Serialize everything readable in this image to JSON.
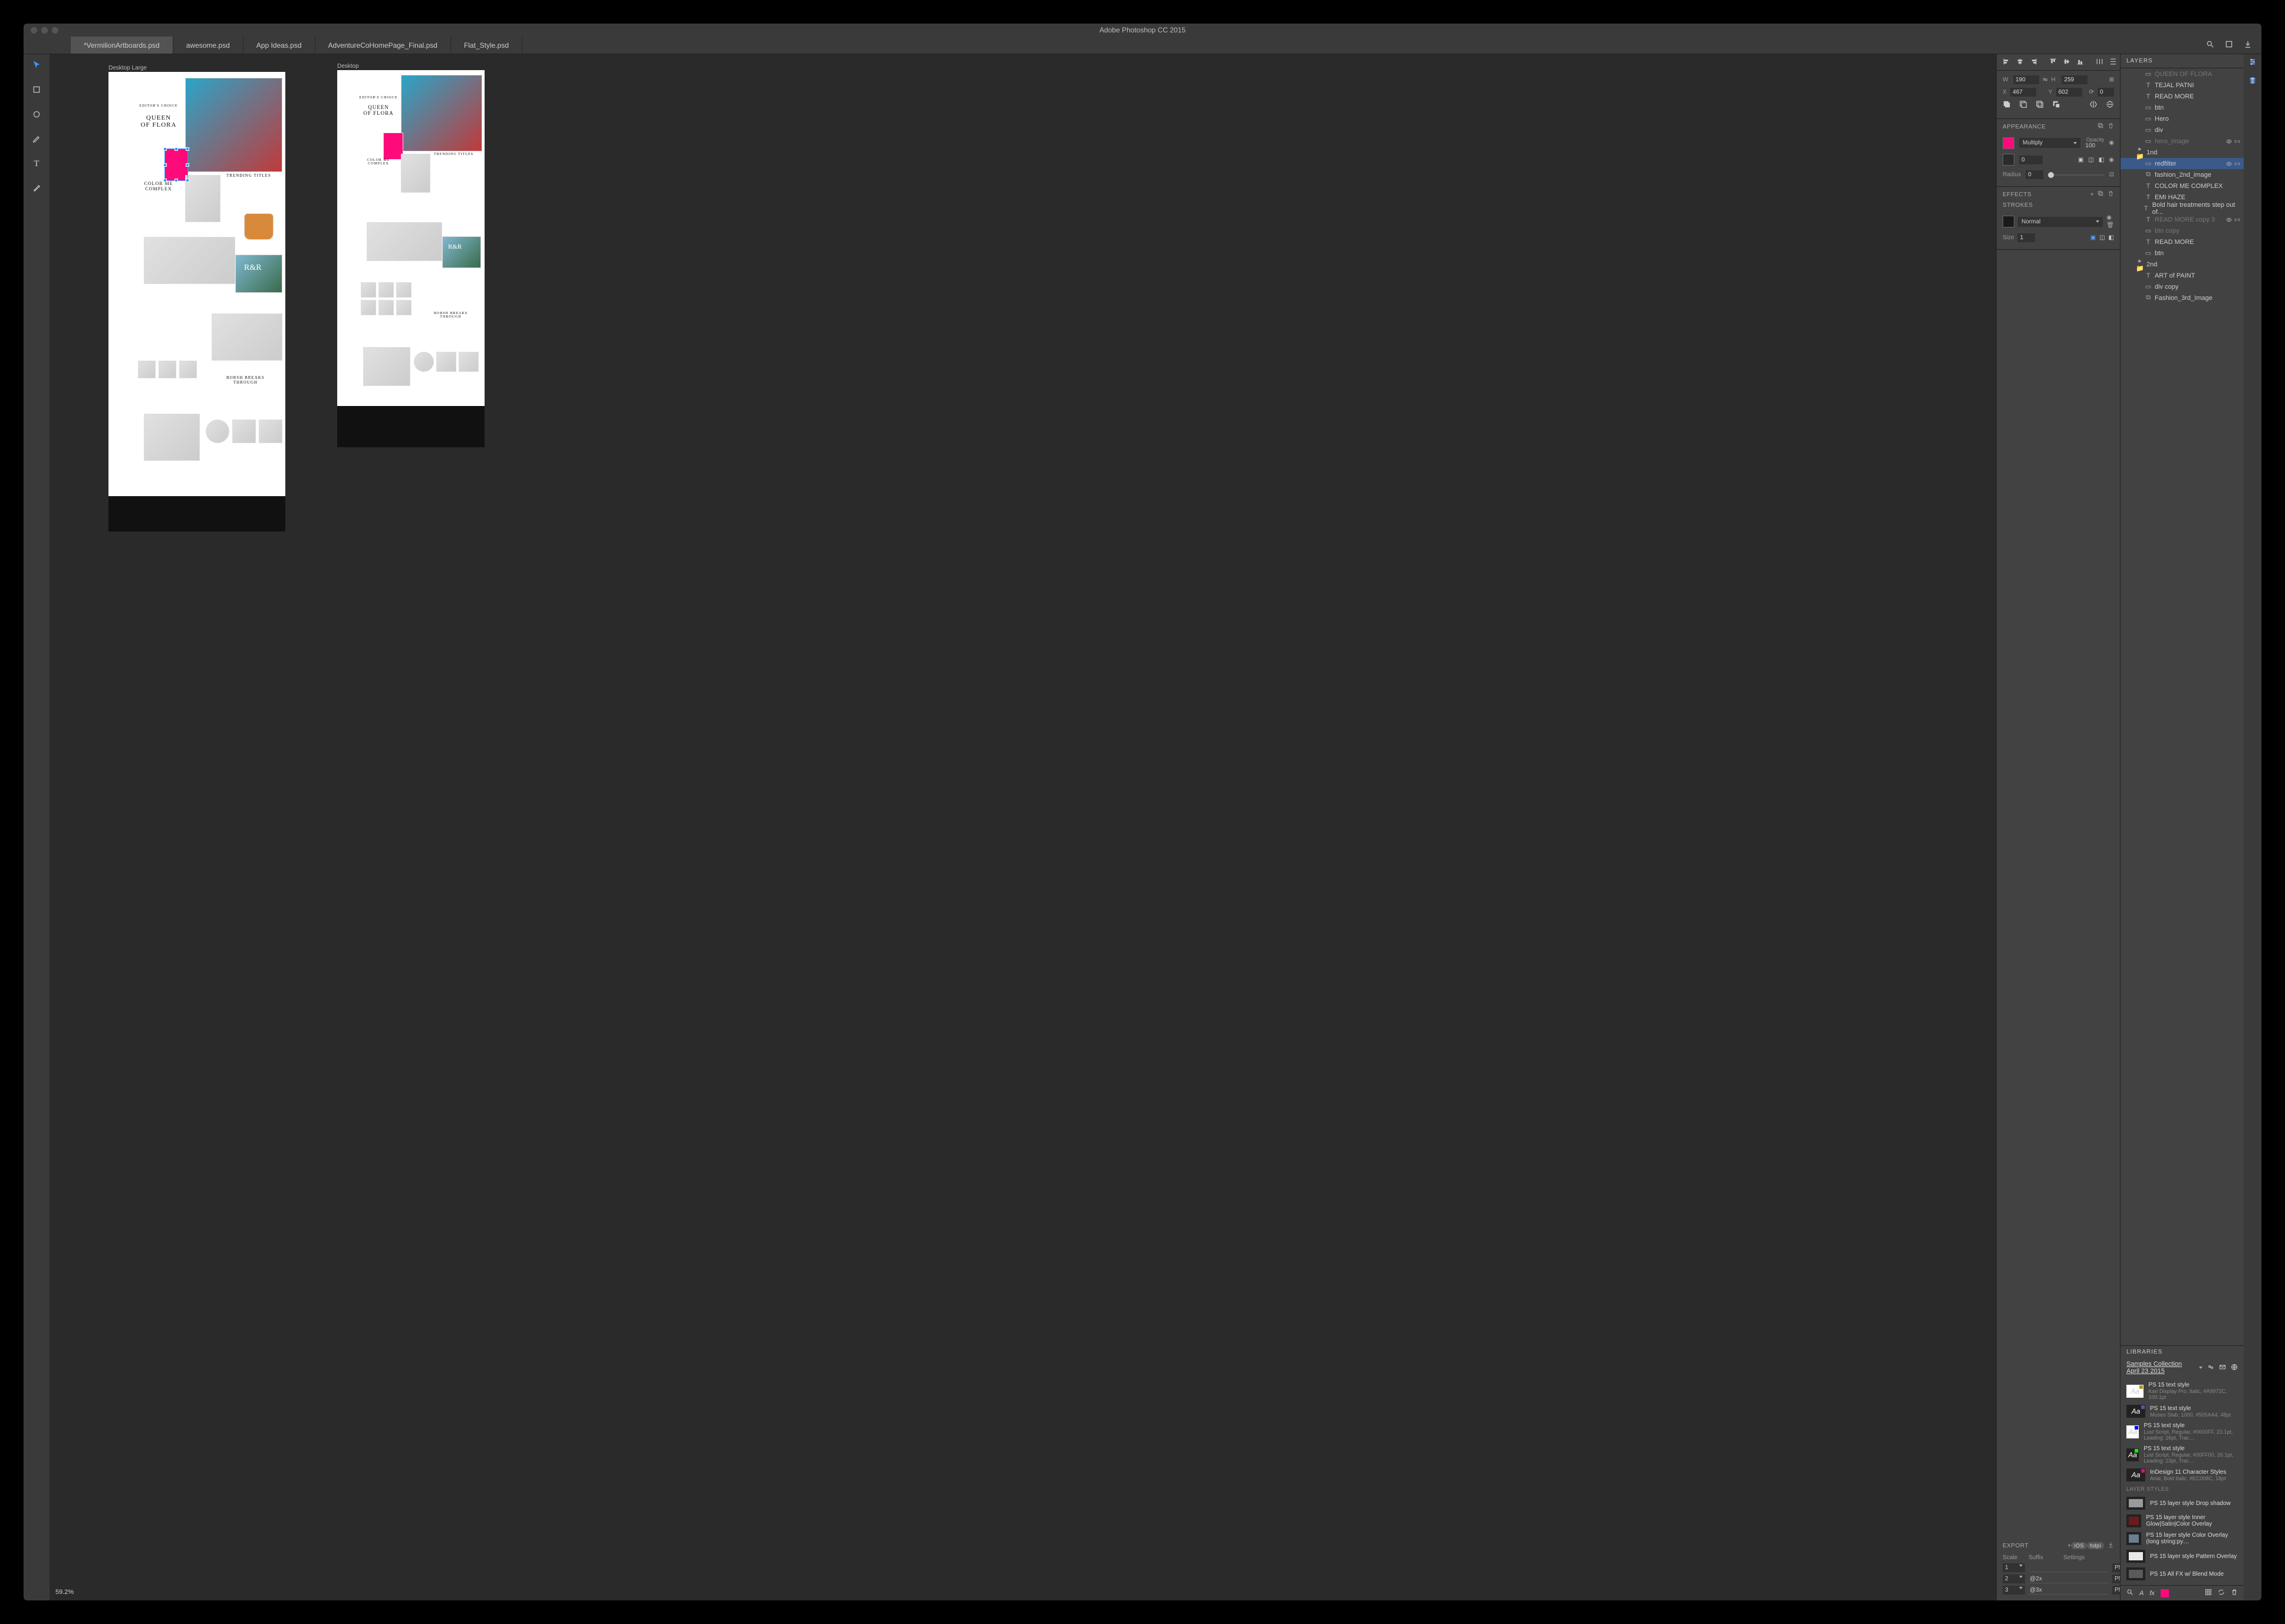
{
  "window": {
    "title": "Adobe Photoshop CC 2015"
  },
  "tabs": [
    {
      "label": "*VermilionArtboards.psd",
      "active": true
    },
    {
      "label": "awesome.psd",
      "active": false
    },
    {
      "label": "App Ideas.psd",
      "active": false
    },
    {
      "label": "AdventureCoHomePage_Final.psd",
      "active": false
    },
    {
      "label": "Flat_Style.psd",
      "active": false
    }
  ],
  "canvas": {
    "zoom": "59.2%",
    "artboards": [
      {
        "label": "Desktop Large"
      },
      {
        "label": "Desktop"
      }
    ]
  },
  "transform": {
    "W": "190",
    "H": "259",
    "X": "467",
    "Y": "602",
    "rotate": "0"
  },
  "appearance": {
    "title": "APPEARANCE",
    "fill": {
      "color": "#ff0a7b",
      "blend": "Multiply",
      "opacityLabel": "Opacity",
      "opacity": "100"
    },
    "stroke": {
      "color": "#2b2b2b",
      "weight": "0"
    },
    "radiusLabel": "Radius",
    "radius": "0"
  },
  "effects": {
    "title": "EFFECTS"
  },
  "strokes": {
    "title": "STROKES",
    "color": "#1a1a1a",
    "mode": "Normal",
    "sizeLabel": "Size",
    "size": "1"
  },
  "export": {
    "title": "EXPORT",
    "cols": {
      "scale": "Scale",
      "suffix": "Suffix",
      "settings": "Settings"
    },
    "badges": [
      "iOS",
      "hdpi"
    ],
    "rows": [
      {
        "scale": "1",
        "suffix": "",
        "format": "PNG"
      },
      {
        "scale": "2",
        "suffix": "@2x",
        "format": "PNG"
      },
      {
        "scale": "3",
        "suffix": "@3x",
        "format": "PNG"
      }
    ]
  },
  "layersPanel": {
    "title": "LAYERS",
    "items": [
      {
        "depth": 2,
        "kind": "rect",
        "name": "QUEEN OF FLORA",
        "dim": true
      },
      {
        "depth": 2,
        "kind": "text",
        "name": "TEJAL PATNI"
      },
      {
        "depth": 2,
        "kind": "text",
        "name": "READ MORE"
      },
      {
        "depth": 2,
        "kind": "rect",
        "name": "btn"
      },
      {
        "depth": 2,
        "kind": "rect",
        "name": "Hero"
      },
      {
        "depth": 2,
        "kind": "rect",
        "name": "div"
      },
      {
        "depth": 2,
        "kind": "rect",
        "name": "hero_image",
        "dim": true,
        "eye": true,
        "link": true
      },
      {
        "depth": 1,
        "kind": "folder",
        "name": "1nd"
      },
      {
        "depth": 2,
        "kind": "rect",
        "name": "redfilter",
        "selected": true,
        "eye": true,
        "link": true
      },
      {
        "depth": 2,
        "kind": "smart",
        "name": "fashion_2nd_image"
      },
      {
        "depth": 2,
        "kind": "text",
        "name": "COLOR ME COMPLEX"
      },
      {
        "depth": 2,
        "kind": "text",
        "name": "EMI HAZE"
      },
      {
        "depth": 2,
        "kind": "text",
        "name": "Bold hair treatments step out of..."
      },
      {
        "depth": 2,
        "kind": "text",
        "name": "READ MORE copy 3",
        "dim": true,
        "eye": true,
        "link": true
      },
      {
        "depth": 2,
        "kind": "rect",
        "name": "btn copy",
        "dim": true
      },
      {
        "depth": 2,
        "kind": "text",
        "name": "READ MORE"
      },
      {
        "depth": 2,
        "kind": "rect",
        "name": "btn"
      },
      {
        "depth": 1,
        "kind": "folder",
        "name": "2nd"
      },
      {
        "depth": 2,
        "kind": "text",
        "name": "ART of PAINT"
      },
      {
        "depth": 2,
        "kind": "rect",
        "name": "div copy"
      },
      {
        "depth": 2,
        "kind": "smart",
        "name": "Fashion_3rd_Image"
      }
    ]
  },
  "libraries": {
    "title": "LIBRARIES",
    "collection": "Samples Collection April 23 2015",
    "textStyles": [
      {
        "title": "PS 15 text style",
        "sub": "Kari Display Pro, Italic, #A9972C, 100.1pt",
        "dot": "#A9972C",
        "thumbDark": false
      },
      {
        "title": "PS 15 text style",
        "sub": "Museo Slab, 1000, #505AA4, 48pt",
        "dot": "#505AA4",
        "thumbDark": true
      },
      {
        "title": "PS 15 text style",
        "sub": "Lust Script, Regular, #0000FF, 23.1pt, Leading: 26pt, Trac…",
        "dot": "#0000FF",
        "thumbDark": false
      },
      {
        "title": "PS 15 text style",
        "sub": "Lust Script, Regular, #00FF00, 26.1pt, Leading: 23pt, Trac…",
        "dot": "#00FF00",
        "thumbDark": true
      },
      {
        "title": "InDesign 11 Character Styles",
        "sub": "Arial, Bold Italic, #EC008C, 18pt",
        "dot": "#EC008C",
        "thumbDark": true
      }
    ],
    "layerStylesTitle": "LAYER STYLES",
    "layerStyles": [
      {
        "title": "PS 15 layer style Drop shadow",
        "fill": "#9a9a9a"
      },
      {
        "title": "PS 15 layer style Inner Glow|Satin|Color Overlay",
        "fill": "#6b1b1b"
      },
      {
        "title": "PS 15 layer style Color Overlay (long string:py…",
        "fill": "#6a7f8f"
      },
      {
        "title": "PS 15 layer style Pattern Overlay",
        "fill": "#e8e8e8"
      },
      {
        "title": "PS 15 All FX w/ Blend Mode",
        "fill": "#5a5a5a"
      }
    ]
  }
}
